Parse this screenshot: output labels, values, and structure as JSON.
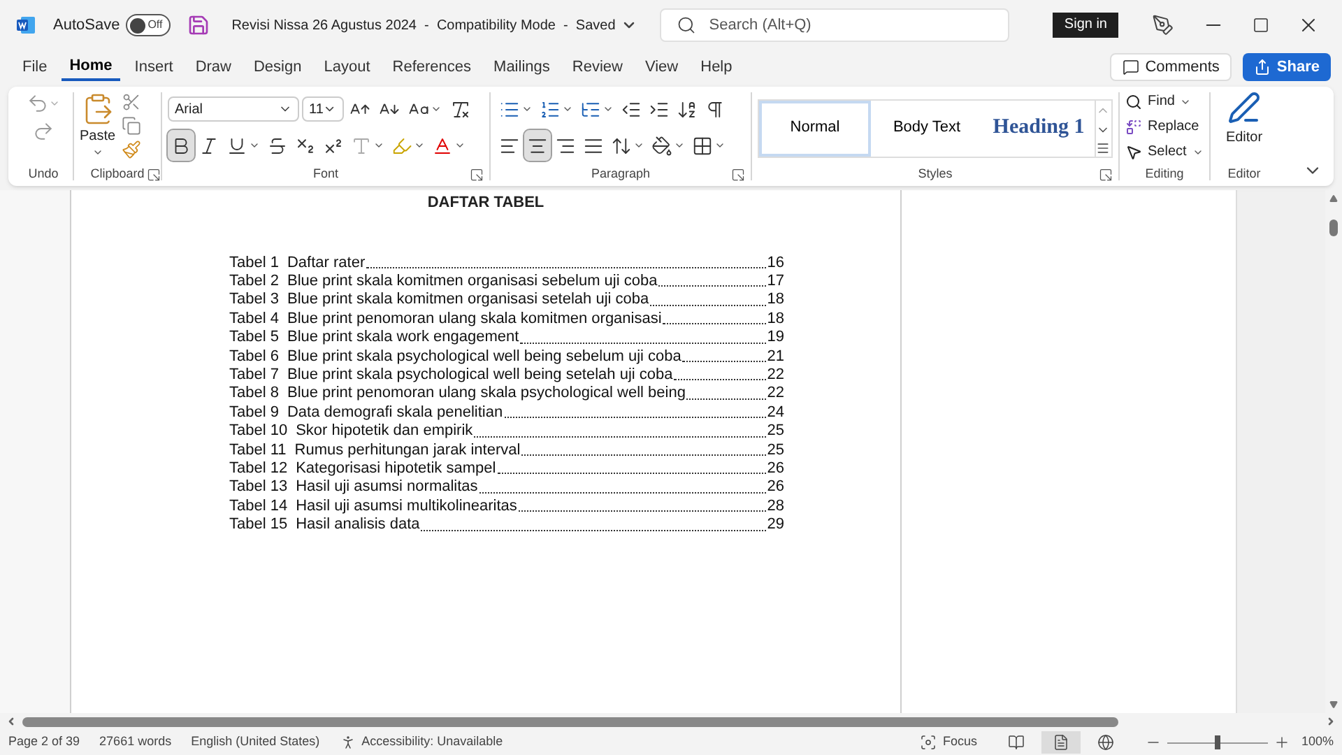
{
  "title_bar": {
    "autosave_label": "AutoSave",
    "autosave": {
      "on": false,
      "label": "Off"
    },
    "document_title": "Revisi Nissa 26 Agustus 2024  -  Compatibility Mode  -  Saved",
    "search": {
      "placeholder": "Search (Alt+Q)"
    },
    "sign_in": "Sign in"
  },
  "ribbon_tabs": [
    {
      "label": "File",
      "selected": false
    },
    {
      "label": "Home",
      "selected": true
    },
    {
      "label": "Insert",
      "selected": false
    },
    {
      "label": "Draw",
      "selected": false
    },
    {
      "label": "Design",
      "selected": false
    },
    {
      "label": "Layout",
      "selected": false
    },
    {
      "label": "References",
      "selected": false
    },
    {
      "label": "Mailings",
      "selected": false
    },
    {
      "label": "Review",
      "selected": false
    },
    {
      "label": "View",
      "selected": false
    },
    {
      "label": "Help",
      "selected": false
    }
  ],
  "comments_button": "Comments",
  "share_button": "Share",
  "ribbon": {
    "undo": {
      "label": "Undo"
    },
    "clipboard": {
      "paste": "Paste",
      "label": "Clipboard"
    },
    "font": {
      "name": "Arial",
      "size": "11",
      "bold": true,
      "label": "Font"
    },
    "paragraph": {
      "alignment": [
        {
          "kind": "left",
          "selected": false
        },
        {
          "kind": "center",
          "selected": true
        },
        {
          "kind": "right",
          "selected": false
        },
        {
          "kind": "justify",
          "selected": false
        }
      ],
      "label": "Paragraph"
    },
    "styles": {
      "items": [
        {
          "label": "Normal",
          "kind": "normal",
          "selected": true
        },
        {
          "label": "Body Text",
          "kind": "body",
          "selected": false
        },
        {
          "label": "Heading 1",
          "kind": "heading",
          "selected": false
        }
      ],
      "label": "Styles"
    },
    "editing": {
      "find": "Find",
      "replace": "Replace",
      "select": "Select",
      "label": "Editing"
    },
    "editor": {
      "button": "Editor",
      "label": "Editor"
    }
  },
  "document": {
    "heading": "DAFTAR TABEL",
    "entries": [
      {
        "number": "Tabel 1",
        "title": "Daftar rater",
        "page": "16"
      },
      {
        "number": "Tabel 2",
        "title": "Blue print skala komitmen organisasi sebelum uji coba",
        "page": "17"
      },
      {
        "number": "Tabel 3",
        "title": "Blue print skala komitmen organisasi setelah uji coba",
        "page": "18"
      },
      {
        "number": "Tabel 4",
        "title": "Blue print penomoran ulang skala komitmen organisasi",
        "page": "18"
      },
      {
        "number": "Tabel 5",
        "title": "Blue print skala work engagement",
        "page": "19"
      },
      {
        "number": "Tabel 6",
        "title": "Blue print skala psychological well being sebelum uji coba",
        "page": "21"
      },
      {
        "number": "Tabel 7",
        "title": "Blue print skala psychological well being setelah uji coba",
        "page": "22"
      },
      {
        "number": "Tabel 8",
        "title": "Blue print penomoran ulang skala psychological well being",
        "page": "22"
      },
      {
        "number": "Tabel 9",
        "title": "Data demografi skala penelitian",
        "page": "24"
      },
      {
        "number": "Tabel 10",
        "title": "Skor hipotetik dan empirik",
        "page": "25"
      },
      {
        "number": "Tabel 11",
        "title": "Rumus perhitungan jarak interval",
        "page": "25"
      },
      {
        "number": "Tabel 12",
        "title": "Kategorisasi hipotetik sampel",
        "page": "26"
      },
      {
        "number": "Tabel 13",
        "title": "Hasil uji asumsi normalitas",
        "page": "26"
      },
      {
        "number": "Tabel 14",
        "title": "Hasil uji asumsi multikolinearitas",
        "page": "28"
      },
      {
        "number": "Tabel 15",
        "title": "Hasil analisis data",
        "page": "29"
      }
    ]
  },
  "status_bar": {
    "page": "Page 2 of 39",
    "words": "27661 words",
    "language": "English (United States)",
    "accessibility": "Accessibility: Unavailable",
    "focus": "Focus",
    "views": [
      {
        "kind": "read",
        "selected": false
      },
      {
        "kind": "print",
        "selected": true
      },
      {
        "kind": "web",
        "selected": false
      }
    ],
    "zoom": {
      "level": 0.5,
      "reading": "100%"
    }
  }
}
